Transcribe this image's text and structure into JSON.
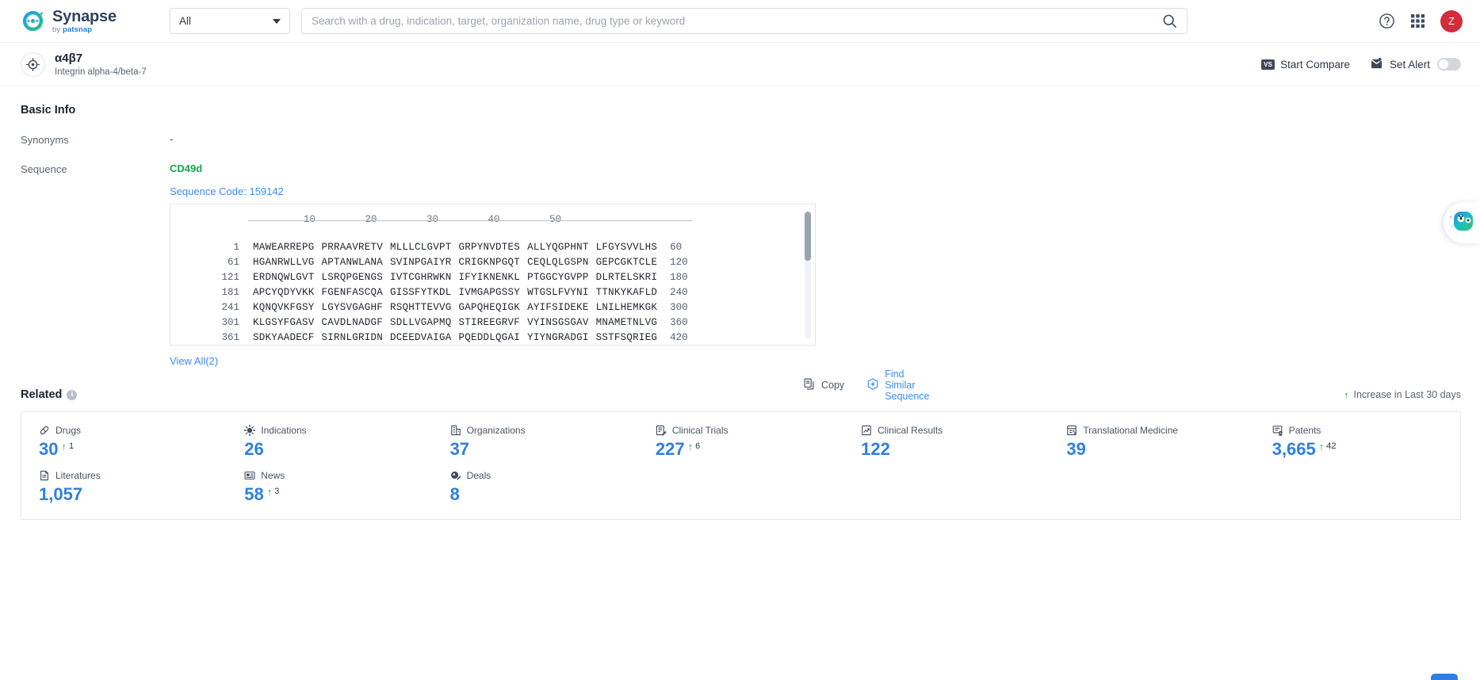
{
  "brand": {
    "name": "Synapse",
    "by": "by ",
    "patsnap": "patsnap",
    "logo_icon": "synapse-logo-icon"
  },
  "header": {
    "scope": {
      "value": "All",
      "caret_icon": "chevron-down-icon"
    },
    "search": {
      "placeholder": "Search with a drug, indication, target, organization name, drug type or keyword",
      "value": "",
      "icon": "search-icon"
    },
    "help_icon": "help-circle-icon",
    "apps_icon": "grid-apps-icon",
    "avatar_initial": "Z",
    "avatar_color": "#d32c3c"
  },
  "target": {
    "icon": "target-crosshair-icon",
    "title": "α4β7",
    "subtitle": "Integrin alpha-4/beta-7",
    "actions": {
      "compare_label": "Start Compare",
      "compare_badge": "VS",
      "alert_label": "Set Alert",
      "alert_icon": "mail-alert-icon",
      "alert_toggle_on": false
    }
  },
  "basic_info": {
    "title": "Basic Info",
    "synonyms_label": "Synonyms",
    "synonyms_value": "-",
    "sequence_label": "Sequence",
    "sequence_name": "CD49d",
    "sequence_code": "Sequence Code: 159142",
    "copy_label": "Copy",
    "copy_icon": "copy-icon",
    "similar_label": "Find Similar Sequence",
    "similar_icon": "find-similar-sequence-icon",
    "view_all": "View All(2)"
  },
  "sequence": {
    "ruler": [
      "10",
      "20",
      "30",
      "40",
      "50"
    ],
    "rows": [
      {
        "start": "1",
        "chunks": [
          "MAWEARREPG",
          "PRRAAVRETV",
          "MLLLCLGVPT",
          "GRPYNVDTES",
          "ALLYQGPHNT",
          "LFGYSVVLHS"
        ],
        "end": "60"
      },
      {
        "start": "61",
        "chunks": [
          "HGANRWLLVG",
          "APTANWLANA",
          "SVINPGAIYR",
          "CRIGKNPGQT",
          "CEQLQLGSPN",
          "GEPCGKTCLE"
        ],
        "end": "120"
      },
      {
        "start": "121",
        "chunks": [
          "ERDNQWLGVT",
          "LSRQPGENGS",
          "IVTCGHRWKN",
          "IFYIKNENKL",
          "PTGGCYGVPP",
          "DLRTELSKRI"
        ],
        "end": "180"
      },
      {
        "start": "181",
        "chunks": [
          "APCYQDYVKK",
          "FGENFASCQA",
          "GISSFYTKDL",
          "IVMGAPGSSY",
          "WTGSLFVYNI",
          "TTNKYKAFLD"
        ],
        "end": "240"
      },
      {
        "start": "241",
        "chunks": [
          "KQNQVKFGSY",
          "LGYSVGAGHF",
          "RSQHTTEVVG",
          "GAPQHEQIGK",
          "AYIFSIDEKE",
          "LNILHEMKGK"
        ],
        "end": "300"
      },
      {
        "start": "301",
        "chunks": [
          "KLGSYFGASV",
          "CAVDLNADGF",
          "SDLLVGAPMQ",
          "STIREEGRVF",
          "VYINSGSGAV",
          "MNAMETNLVG"
        ],
        "end": "360"
      },
      {
        "start": "361",
        "chunks": [
          "SDKYAADECF",
          "SIRNLGRIDN",
          "DCEEDVAIGA",
          "PQEDDLQGAI",
          "YIYNGRADGI",
          "SSTFSQRIEG"
        ],
        "end": "420"
      }
    ]
  },
  "related": {
    "title": "Related",
    "info_icon": "info-icon",
    "legend": "Increase in Last 30 days",
    "legend_arrow_icon": "arrow-up-icon",
    "stats": [
      {
        "label": "Drugs",
        "icon": "capsule-icon",
        "value": "30",
        "delta": "1"
      },
      {
        "label": "Indications",
        "icon": "virus-icon",
        "value": "26",
        "delta": ""
      },
      {
        "label": "Organizations",
        "icon": "building-icon",
        "value": "37",
        "delta": ""
      },
      {
        "label": "Clinical Trials",
        "icon": "clinical-trial-icon",
        "value": "227",
        "delta": "6"
      },
      {
        "label": "Clinical Results",
        "icon": "chart-doc-icon",
        "value": "122",
        "delta": ""
      },
      {
        "label": "Translational Medicine",
        "icon": "lab-doc-icon",
        "value": "39",
        "delta": ""
      },
      {
        "label": "Patents",
        "icon": "patent-icon",
        "value": "3,665",
        "delta": "42"
      },
      {
        "label": "Literatures",
        "icon": "literature-icon",
        "value": "1,057",
        "delta": ""
      },
      {
        "label": "News",
        "icon": "news-icon",
        "value": "58",
        "delta": "3"
      },
      {
        "label": "Deals",
        "icon": "deal-icon",
        "value": "8",
        "delta": ""
      }
    ]
  },
  "assistant": {
    "icon": "ai-assistant-icon"
  },
  "colors": {
    "accent_blue": "#2f7fe0",
    "link_blue": "#3d8bf2",
    "green": "#17a24a",
    "increase_green": "#2aa845",
    "avatar_red": "#d32c3c"
  }
}
